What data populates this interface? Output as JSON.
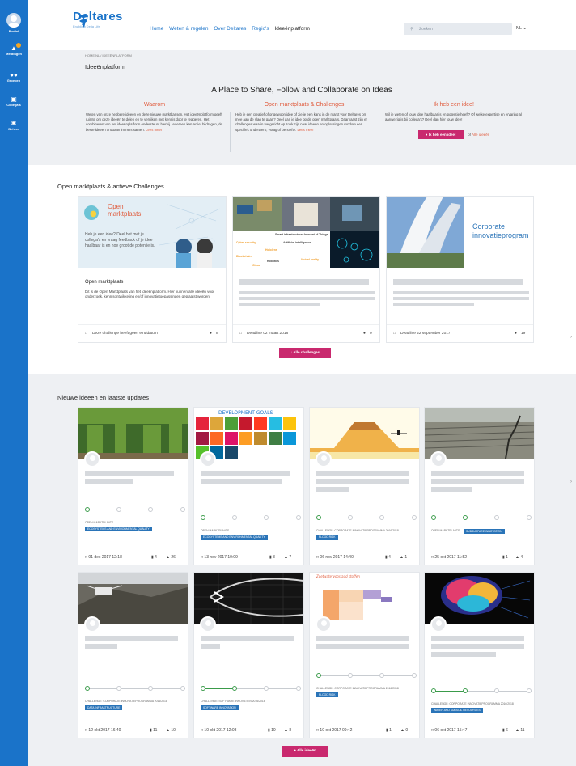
{
  "sidebar": {
    "items": [
      {
        "label": "Profiel",
        "icon": "user-avatar-icon"
      },
      {
        "label": "Meldingen",
        "icon": "bell-icon"
      },
      {
        "label": "Groepen",
        "icon": "group-icon"
      },
      {
        "label": "Collega's",
        "icon": "contacts-icon"
      },
      {
        "label": "Beheer",
        "icon": "gear-icon"
      }
    ]
  },
  "header": {
    "logo_text": "Deltares",
    "logo_sub": "Enabling Delta Life",
    "nav": [
      "Home",
      "Weten & regelen",
      "Over Deltares",
      "Regio's",
      "Ideeënplatform"
    ],
    "search_placeholder": "Zoeken",
    "lang": "NL"
  },
  "breadcrumb": "HOME NL / IDEEËNPLATFORM",
  "page_title": "Ideeënplatform",
  "hero": {
    "title": "A Place to Share, Follow and Collaborate on Ideas",
    "cols": [
      {
        "heading": "Waarom",
        "text": "Weten van onze hebbere ideeën en deze nieuwe marktkansen. Het ideeënplatform geeft ruimte om deze ideeën te delen en te verrijken met kennis door te reageren. Het combineren van het ideeënplatform ondersteunt hierbij. Iedereen kan actief bijdragen, de beste ideeën ontstaan immers samen.",
        "link": "Lees meer"
      },
      {
        "heading": "Open marktplaats & Challenges",
        "text": "Heb je een creatief of ongewoon idee of zie je een kans in de markt voor Deltares om mee aan de slag te gaan? Deel dan je idee op de open marktplaats. Daarnaast zijn er challenges waarin we gericht op zoek zijn naar ideeën en oplossingen rondom een specifiek onderwerp, vraag of behoefte.",
        "link": "Lees meer"
      },
      {
        "heading": "Ik heb een idee!",
        "text": "Wil je weten of jouw idee haalbaar is en potentie heeft? Of welke expertise en ervaring al aanwezig is bij collega's? Deel dan hier jouw idee!",
        "button": "Ik heb een idee!",
        "or_text": "of",
        "link": "Alle ideeën"
      }
    ]
  },
  "challenges": {
    "title": "Open marktplaats & actieve Challenges",
    "cards": [
      {
        "img_title_1": "Open",
        "img_title_2": "marktplaats",
        "img_text": "Heb je een idee? Deel het met je collega's en vraag feedback of je idee haalbaar is en hoe groot de potentie is.",
        "name": "Open marktplaats",
        "desc": "Dit is de Open Marktplaats van het ideeënplatform. Hier kunnen alle ideeën voor onderzoek, kennisontwikkeling en/of innovatietoepassingen geplaatst worden.",
        "deadline": "Deze challenge heeft geen einddatum",
        "count": "8"
      },
      {
        "tags": [
          "Smart infrastructures",
          "Internet of Things",
          "Cyber security",
          "Artificial intelligence",
          "Hololens",
          "Blockchain",
          "Robotics",
          "Virtual reality",
          "Cloud"
        ],
        "deadline": "Deadline 02 maart 2018",
        "count": "0"
      },
      {
        "img_title_1": "Corporate",
        "img_title_2": "innovatieprogram",
        "deadline": "Deadline 22 september 2017",
        "count": "19"
      }
    ],
    "button": "Alle challenges"
  },
  "ideas": {
    "title": "Nieuwe ideeën en laatste updates",
    "items": [
      {
        "tag1": "OPEN MARKTPLAATS",
        "tag2": "ECOSYSTEMS AND ENVIRONMENTAL QUALITY",
        "date": "01 dec 2017 12:18",
        "comments": "4",
        "likes": "26",
        "progress_steps": 2
      },
      {
        "tag1": "OPEN MARKTPLAATS",
        "tag2": "ECOSYSTEMS AND ENVIRONMENTAL QUALITY",
        "date": "13 nov 2017 10:09",
        "comments": "3",
        "likes": "7",
        "progress_steps": 0
      },
      {
        "tag1": "CHALLENGE: CORPORATE INNOVATIEPROGRAMMA 2016/2018",
        "tag2": "FLOOD RISK",
        "date": "06 nov 2017 14:40",
        "comments": "4",
        "likes": "1",
        "progress_steps": 0
      },
      {
        "tag1": "OPEN MARKTPLAATS",
        "tag2": "SUBSURFACE INNOVATION",
        "date": "25 okt 2017 11:52",
        "comments": "1",
        "likes": "4",
        "progress_steps": 1
      },
      {
        "tag1": "CHALLENGE: CORPORATE INNOVATIEPROGRAMMA 2016/2018",
        "tag2": "DATA INFRASTRUCTURE",
        "date": "12 okt 2017 16:40",
        "comments": "11",
        "likes": "10",
        "progress_steps": 0
      },
      {
        "tag1": "CHALLENGE: SOFTWARE INNOVATIEN 2016/2018",
        "tag2": "SOFTWARE INNOVATION",
        "date": "10 okt 2017 12:08",
        "comments": "10",
        "likes": "8",
        "progress_steps": 1
      },
      {
        "tag1": "CHALLENGE: CORPORATE INNOVATIEPROGRAMMA 2016/2018",
        "tag2": "FLOOD RISK",
        "date": "10 okt 2017 09:42",
        "comments": "1",
        "likes": "0",
        "progress_steps": 0
      },
      {
        "tag1": "CHALLENGE: CORPORATE INNOVATIEPROGRAMMA 2016/2018",
        "tag2": "WATER AND SUBSOIL RESOURCES",
        "date": "06 okt 2017 15:47",
        "comments": "6",
        "likes": "11",
        "progress_steps": 1
      }
    ],
    "button": "Alle ideeën",
    "sdg_banner": "DEVELOPMENT GOALS",
    "doc_title": "Zoetwatervoorraad stoffen"
  },
  "colors": {
    "brand_blue": "#1a73c9",
    "accent_pink": "#c9296e",
    "accent_orange": "#e05a3b",
    "progress_green": "#3a9b4a",
    "tag_blue": "#2a74b8"
  }
}
